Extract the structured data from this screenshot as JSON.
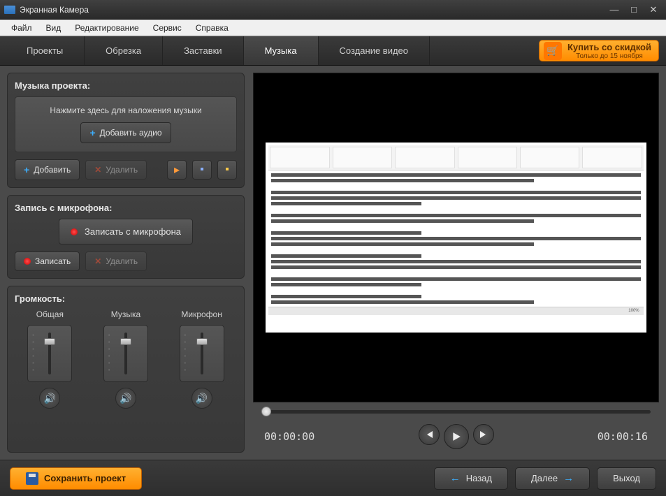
{
  "window": {
    "title": "Экранная Камера"
  },
  "menu": {
    "items": [
      "Файл",
      "Вид",
      "Редактирование",
      "Сервис",
      "Справка"
    ]
  },
  "tabs": {
    "items": [
      "Проекты",
      "Обрезка",
      "Заставки",
      "Музыка",
      "Создание видео"
    ],
    "active": 3
  },
  "buy": {
    "main": "Купить со скидкой",
    "sub": "Только до 15 ноября"
  },
  "music": {
    "title": "Музыка проекта:",
    "hint": "Нажмите здесь для наложения музыки",
    "add_audio": "Добавить аудио",
    "add": "Добавить",
    "delete": "Удалить"
  },
  "mic": {
    "title": "Запись с микрофона:",
    "record_from_mic": "Записать с микрофона",
    "record": "Записать",
    "delete": "Удалить"
  },
  "volume": {
    "title": "Громкость:",
    "labels": [
      "Общая",
      "Музыка",
      "Микрофон"
    ]
  },
  "player": {
    "current": "00:00:00",
    "total": "00:00:16",
    "doc_zoom": "100%"
  },
  "footer": {
    "save": "Сохранить проект",
    "back": "Назад",
    "next": "Далее",
    "exit": "Выход"
  }
}
